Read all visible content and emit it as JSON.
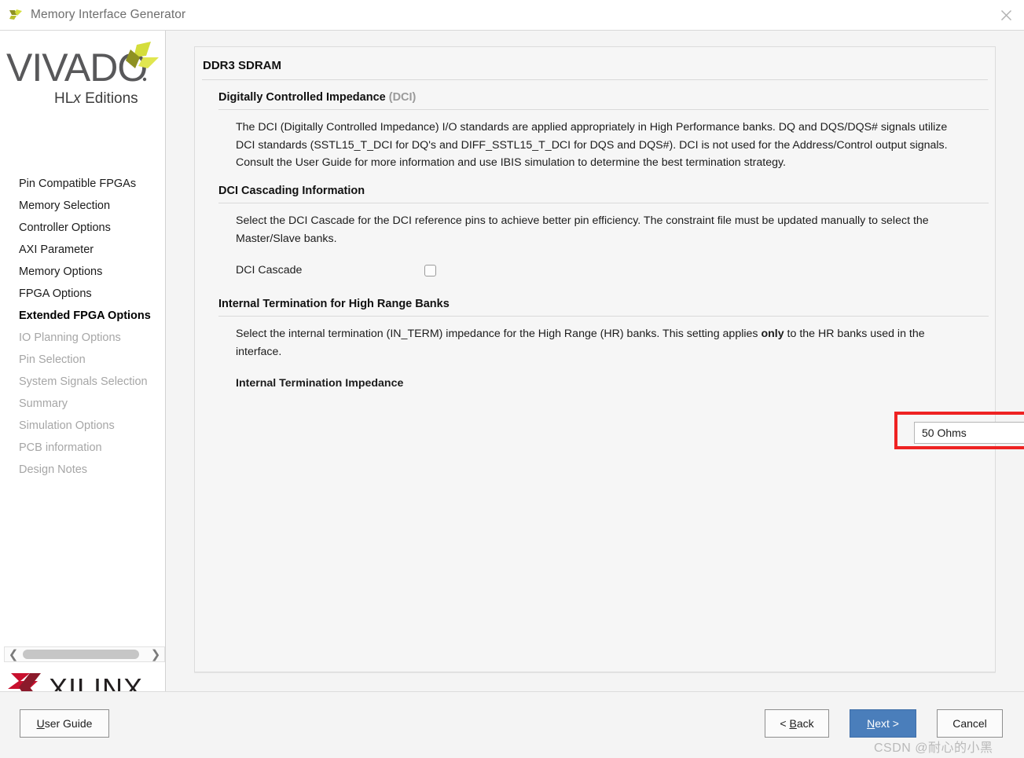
{
  "window": {
    "title": "Memory Interface Generator",
    "app_icon": "vivado-chevron-icon",
    "close_icon": "close-icon"
  },
  "sidebar": {
    "logo": {
      "product": "VIVADO",
      "edition": "HLx Editions"
    },
    "items": [
      {
        "label": "Pin Compatible FPGAs",
        "state": "enabled"
      },
      {
        "label": "Memory Selection",
        "state": "enabled"
      },
      {
        "label": "Controller Options",
        "state": "enabled"
      },
      {
        "label": "AXI Parameter",
        "state": "enabled"
      },
      {
        "label": "Memory Options",
        "state": "enabled"
      },
      {
        "label": "FPGA Options",
        "state": "enabled"
      },
      {
        "label": "Extended FPGA Options",
        "state": "active"
      },
      {
        "label": "IO Planning Options",
        "state": "disabled"
      },
      {
        "label": "Pin Selection",
        "state": "disabled"
      },
      {
        "label": "System Signals Selection",
        "state": "disabled"
      },
      {
        "label": "Summary",
        "state": "disabled"
      },
      {
        "label": "Simulation Options",
        "state": "disabled"
      },
      {
        "label": "PCB information",
        "state": "disabled"
      },
      {
        "label": "Design Notes",
        "state": "disabled"
      }
    ],
    "scrollbar": {
      "left_arrow_icon": "chevron-left-icon",
      "right_arrow_icon": "chevron-right-icon"
    },
    "vendor_logo": "XILINX"
  },
  "main": {
    "page_title": "DDR3 SDRAM",
    "sections": [
      {
        "id": "dci",
        "heading": "Digitally Controlled Impedance",
        "heading_suffix": "(DCI)",
        "body_html": "The DCI (Digitally Controlled Impedance) I/O standards are applied appropriately in High Performance banks. DQ and DQS/DQS# signals utilize DCI standards (SSTL15_T_DCI for DQ's and DIFF_SSTL15_T_DCI for DQS and DQS#). DCI is not used for the Address/Control output signals. Consult the User Guide for more information and use IBIS simulation to determine the best termination strategy."
      },
      {
        "id": "dci-cascading",
        "heading": "DCI Cascading Information",
        "body_html": "Select the DCI Cascade for the DCI reference pins to achieve better pin efficiency. The constraint file must be updated manually to select the Master/Slave banks.",
        "field_label": "DCI Cascade",
        "checkbox_checked": false
      },
      {
        "id": "internal-termination",
        "heading": "Internal Termination for High Range Banks",
        "body_html": "Select the internal termination (IN_TERM) impedance for the High Range (HR) banks. This setting applies <b>only</b> to the HR banks used in the interface.",
        "field_label": "Internal Termination Impedance"
      }
    ],
    "impedance_dropdown": {
      "value": "50 Ohms",
      "caret_icon": "chevron-down-icon",
      "highlight_color": "#ee2222"
    }
  },
  "footer": {
    "user_guide": {
      "prefix": "U",
      "rest": "ser Guide"
    },
    "back": {
      "prefix": "< ",
      "mnemonic": "B",
      "rest": "ack"
    },
    "next": {
      "mnemonic": "N",
      "rest": "ext >"
    },
    "cancel": {
      "label": "Cancel"
    },
    "next_accent_color": "#4a7ebb"
  },
  "watermark": "CSDN @耐心的小黑"
}
